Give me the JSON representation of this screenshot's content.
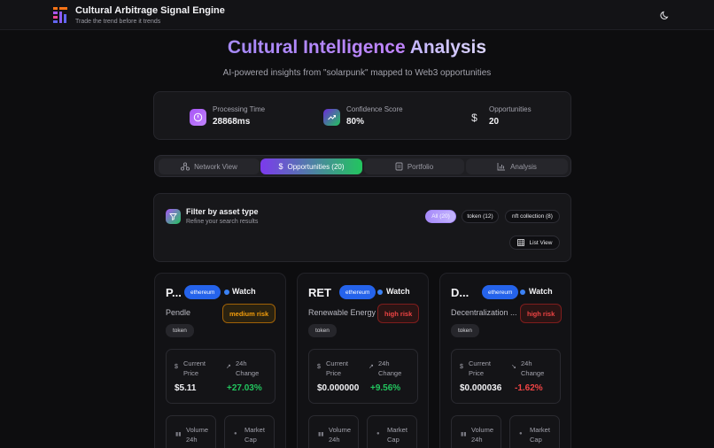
{
  "app": {
    "title": "Cultural Arbitrage Signal Engine",
    "subtitle": "Trade the trend before it trends",
    "logo_icon": "stacked-bars-logo",
    "theme_icon": "moon-icon"
  },
  "hero": {
    "title_part1": "Cultural Intelligence",
    "title_part2": "Analysis",
    "subtitle": "AI-powered insights from \"solarpunk\" mapped to Web3 opportunities"
  },
  "stats": [
    {
      "label": "Processing Time",
      "value": "28868ms",
      "icon": "clock-icon",
      "color": "#a855f7"
    },
    {
      "label": "Confidence Score",
      "value": "80%",
      "icon": "trending-up-icon",
      "color": "#22c55e"
    },
    {
      "label": "Opportunities",
      "value": "20",
      "icon": "dollar-icon",
      "color": "#e6e6ea"
    }
  ],
  "tabs": [
    {
      "label": "Network View",
      "icon": "network-icon"
    },
    {
      "label": "Opportunities (20)",
      "icon": "dollar-icon",
      "active": true
    },
    {
      "label": "Portfolio",
      "icon": "clipboard-icon"
    },
    {
      "label": "Analysis",
      "icon": "bar-chart-icon"
    }
  ],
  "filter": {
    "title": "Filter by asset type",
    "subtitle": "Refine your search results",
    "chips": [
      "All (20)",
      "token (12)",
      "nft collection (8)"
    ],
    "view_label": "List View"
  },
  "card_labels": {
    "watch": "Watch",
    "current_price": [
      "Current",
      "Price"
    ],
    "change_24h": [
      "24h",
      "Change"
    ],
    "volume_24h": [
      "Volume",
      "24h"
    ],
    "market_cap": [
      "Market",
      "Cap"
    ]
  },
  "cards": [
    {
      "symbol": "P...",
      "name": "Pendle",
      "chain": "ethereum",
      "risk": "medium risk",
      "type": "token",
      "price": "$5.11",
      "change": "+27.03%",
      "change_color": "#22c55e"
    },
    {
      "symbol": "RET",
      "name": "Renewable Energy ...",
      "chain": "ethereum",
      "risk": "high risk",
      "type": "token",
      "price": "$0.000000",
      "change": "+9.56%",
      "change_color": "#22c55e"
    },
    {
      "symbol": "D...",
      "name": "Decentralization ...",
      "chain": "ethereum",
      "risk": "high risk",
      "type": "token",
      "price": "$0.000036",
      "change": "-1.62%",
      "change_color": "#ef4444"
    }
  ]
}
